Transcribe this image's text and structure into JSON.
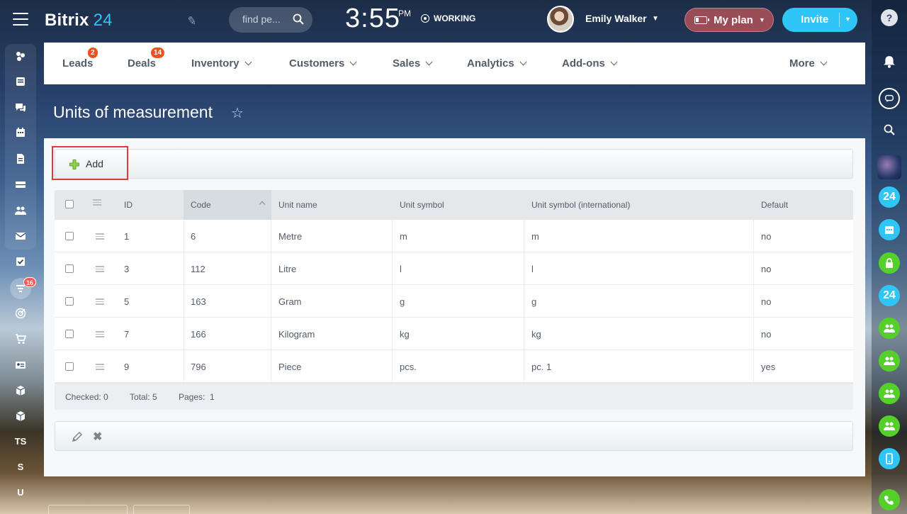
{
  "header": {
    "logo": "Bitrix",
    "logo_num": "24",
    "search_placeholder": "find pe...",
    "time": "3:55",
    "time_suffix": "PM",
    "status": "WORKING",
    "user_name": "Emily Walker",
    "plan_label": "My plan",
    "invite_label": "Invite",
    "plan_color": "#9a4c57",
    "invite_color": "#2fc6f6"
  },
  "crm_nav": {
    "items": [
      {
        "label": "Leads",
        "badge": "2"
      },
      {
        "label": "Deals",
        "badge": "14"
      },
      {
        "label": "Inventory"
      },
      {
        "label": "Customers"
      },
      {
        "label": "Sales"
      },
      {
        "label": "Analytics"
      },
      {
        "label": "Add-ons"
      },
      {
        "label": "More"
      }
    ]
  },
  "left_sidebar": {
    "icons": [
      "activity-stream-icon",
      "feed-icon",
      "chat-icon",
      "calendar-icon",
      "documents-icon",
      "drive-icon",
      "contacts-icon",
      "mail-icon",
      "tasks-icon",
      "crm-filter-icon",
      "target-icon",
      "cart-icon",
      "id-card-icon",
      "box-icon",
      "box-icon"
    ],
    "crm_badge": "16",
    "letters": [
      "TS",
      "S",
      "U"
    ]
  },
  "right_sidebar": {
    "icons": [
      "help-icon",
      "bell-icon",
      "chat-bubble-icon",
      "search-icon",
      "avatar-group-icon",
      "bitrix24-icon",
      "calendar-icon",
      "lock-icon",
      "bitrix24-icon",
      "users-icon",
      "users-icon",
      "users-icon",
      "users-icon",
      "phone-icon",
      "call-icon"
    ],
    "b24_label": "24"
  },
  "page": {
    "title": "Units of measurement"
  },
  "toolbar": {
    "add_label": "Add"
  },
  "table": {
    "columns": [
      "ID",
      "Code",
      "Unit name",
      "Unit symbol",
      "Unit symbol (international)",
      "Default"
    ],
    "rows": [
      {
        "id": "1",
        "code": "6",
        "name": "Metre",
        "symbol": "m",
        "intl": "m",
        "default": "no"
      },
      {
        "id": "3",
        "code": "112",
        "name": "Litre",
        "symbol": "l",
        "intl": "l",
        "default": "no"
      },
      {
        "id": "5",
        "code": "163",
        "name": "Gram",
        "symbol": "g",
        "intl": "g",
        "default": "no"
      },
      {
        "id": "7",
        "code": "166",
        "name": "Kilogram",
        "symbol": "kg",
        "intl": "kg",
        "default": "no"
      },
      {
        "id": "9",
        "code": "796",
        "name": "Piece",
        "symbol": "pcs.",
        "intl": "pc. 1",
        "default": "yes"
      }
    ],
    "footer": {
      "checked": "Checked: 0",
      "total": "Total: 5",
      "pages": "Pages:  1"
    }
  }
}
